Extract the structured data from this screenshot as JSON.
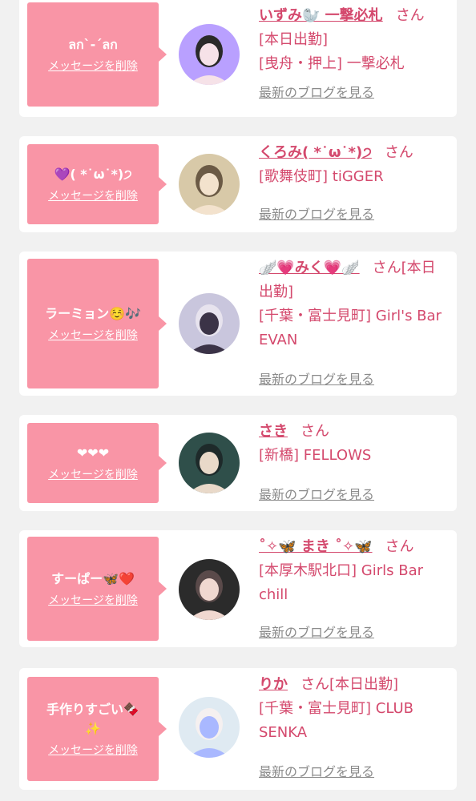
{
  "entries": [
    {
      "message": "ลก`-ˊลก",
      "delete_label": "メッセージを削除",
      "name": "いずみ🦭 一撃必札",
      "san": "さん",
      "details": [
        "[本日出勤]",
        "[曳舟・押上] 一撃必札"
      ],
      "blog_label": "最新のブログを見る",
      "avatar_colors": [
        "#b9a0ff",
        "#f6e2e8",
        "#2a2a2a"
      ]
    },
    {
      "message": "💜( *˙ω˙*)੭",
      "delete_label": "メッセージを削除",
      "name": "くろみ( *˙ω˙*)੭",
      "san": "さん",
      "details": [
        "[歌舞伎町] tiGGER"
      ],
      "blog_label": "最新のブログを見る",
      "avatar_colors": [
        "#d8c9a8",
        "#f3e2cd",
        "#6b5a45"
      ]
    },
    {
      "message": "ラーミョン☺️🎶",
      "delete_label": "メッセージを削除",
      "name": "🪽💗みく💗🪽",
      "san": "さん[本日出勤]",
      "details": [
        "[千葉・富士見町] Girl's Bar EVAN"
      ],
      "blog_label": "最新のブログを見る",
      "avatar_colors": [
        "#c9c6dd",
        "#3b3347",
        "#e7e3ee"
      ]
    },
    {
      "message": "❤❤❤",
      "delete_label": "メッセージを削除",
      "name": "さき",
      "san": "さん",
      "details": [
        "[新橋] FELLOWS"
      ],
      "blog_label": "最新のブログを見る",
      "avatar_colors": [
        "#2f4f4a",
        "#e9d9c9",
        "#1e2a2a"
      ]
    },
    {
      "message": "すーぱー🦋❤️",
      "delete_label": "メッセージを削除",
      "name": "˚✧🦋 まき ˚✧🦋",
      "san": "さん",
      "details": [
        "[本厚木駅北口] Girls Bar chill"
      ],
      "blog_label": "最新のブログを見る",
      "avatar_colors": [
        "#2b2b2b",
        "#f0d8d0",
        "#5a4a4a"
      ]
    },
    {
      "message": "手作りすごい🍫✨",
      "delete_label": "メッセージを削除",
      "name": "りか",
      "san": "さん[本日出勤]",
      "details": [
        "[千葉・富士見町] CLUB SENKA"
      ],
      "blog_label": "最新のブログを見る",
      "avatar_colors": [
        "#dfeaf2",
        "#a9b8ff",
        "#f5f0f0"
      ]
    }
  ]
}
